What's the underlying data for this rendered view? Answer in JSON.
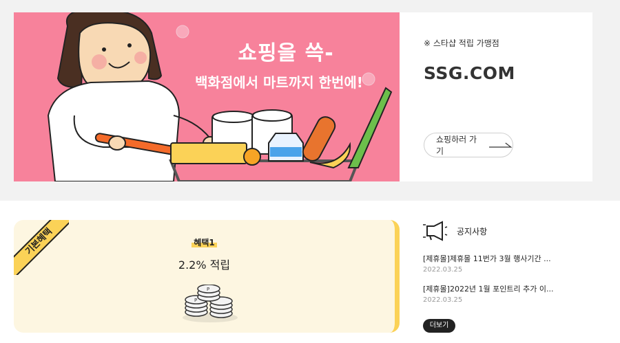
{
  "banner": {
    "title": "쇼핑을 쓱-",
    "subtitle": "백화점에서 마트까지 한번에!",
    "background_color": "#f7829b"
  },
  "store": {
    "note": "※ 스타샵 적립 가맹점",
    "brand": "SSG.COM",
    "shop_button_label": "쇼핑하러 가기"
  },
  "benefit": {
    "ribbon_label": "기본혜택",
    "tag": "혜택1",
    "value": "2.2% 적립",
    "accent_color": "#fbd257"
  },
  "notice": {
    "title": "공지사항",
    "items": [
      {
        "title": "[제휴몰]제휴몰 11번가 3월 행사기간 ...",
        "date": "2022.03.25"
      },
      {
        "title": "[제휴몰]2022년 1월 포인트리 추가 이...",
        "date": "2022.03.25"
      }
    ],
    "more_label": "더보기"
  }
}
